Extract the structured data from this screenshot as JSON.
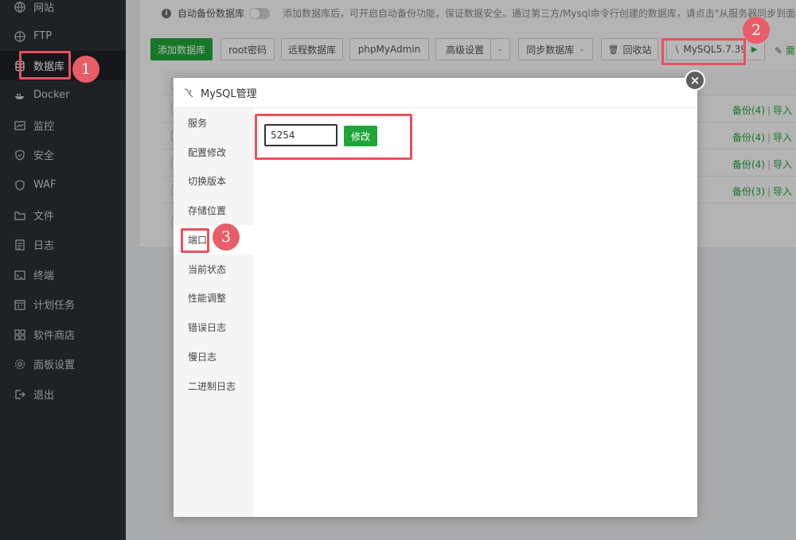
{
  "sidebar": {
    "items": [
      {
        "label": "网站",
        "icon": "globe-icon"
      },
      {
        "label": "FTP",
        "icon": "ftp-globe-icon"
      },
      {
        "label": "数据库",
        "icon": "database-icon",
        "active": true
      },
      {
        "label": "Docker",
        "icon": "docker-icon"
      },
      {
        "label": "监控",
        "icon": "monitor-icon"
      },
      {
        "label": "安全",
        "icon": "shield-check-icon"
      },
      {
        "label": "WAF",
        "icon": "shield-icon"
      },
      {
        "label": "文件",
        "icon": "folder-icon"
      },
      {
        "label": "日志",
        "icon": "log-icon"
      },
      {
        "label": "终端",
        "icon": "terminal-icon"
      },
      {
        "label": "计划任务",
        "icon": "calendar-icon"
      },
      {
        "label": "软件商店",
        "icon": "grid-icon"
      },
      {
        "label": "面板设置",
        "icon": "gear-icon"
      },
      {
        "label": "退出",
        "icon": "logout-icon"
      }
    ]
  },
  "toolbar": {
    "auto_backup_label": "自动备份数据库",
    "notice": "添加数据库后，可开启自动备份功能，保证数据安全。通过第三方/Mysql命令行创建的数据库，请点击\"从服务器同步到面板",
    "add_db": "添加数据库",
    "root_pwd": "root密码",
    "remote_db": "远程数据库",
    "phpmyadmin": "phpMyAdmin",
    "advanced": "高级设置",
    "sync_db": "同步数据库",
    "recycle": "回收站",
    "mysql_version": "MySQL5.7.39",
    "extra": "需"
  },
  "table": {
    "rows": [
      {
        "backup": "备份(4)",
        "import": "导入"
      },
      {
        "backup": "备份(4)",
        "import": "导入"
      },
      {
        "backup": "备份(4)",
        "import": "导入"
      },
      {
        "backup": "备份(3)",
        "import": "导入"
      }
    ]
  },
  "modal": {
    "title": "MySQL管理",
    "close": "×",
    "nav": [
      "服务",
      "配置修改",
      "切换版本",
      "存储位置",
      "端口",
      "当前状态",
      "性能调整",
      "错误日志",
      "慢日志",
      "二进制日志"
    ],
    "active_nav_index": 4,
    "port_value": "5254",
    "modify_label": "修改"
  },
  "annotations": {
    "badge1": "1",
    "badge2": "2",
    "badge3": "3",
    "color": "#e8515f"
  },
  "colors": {
    "sidebar_bg": "#2b2f33",
    "accent_green": "#20a53a"
  }
}
